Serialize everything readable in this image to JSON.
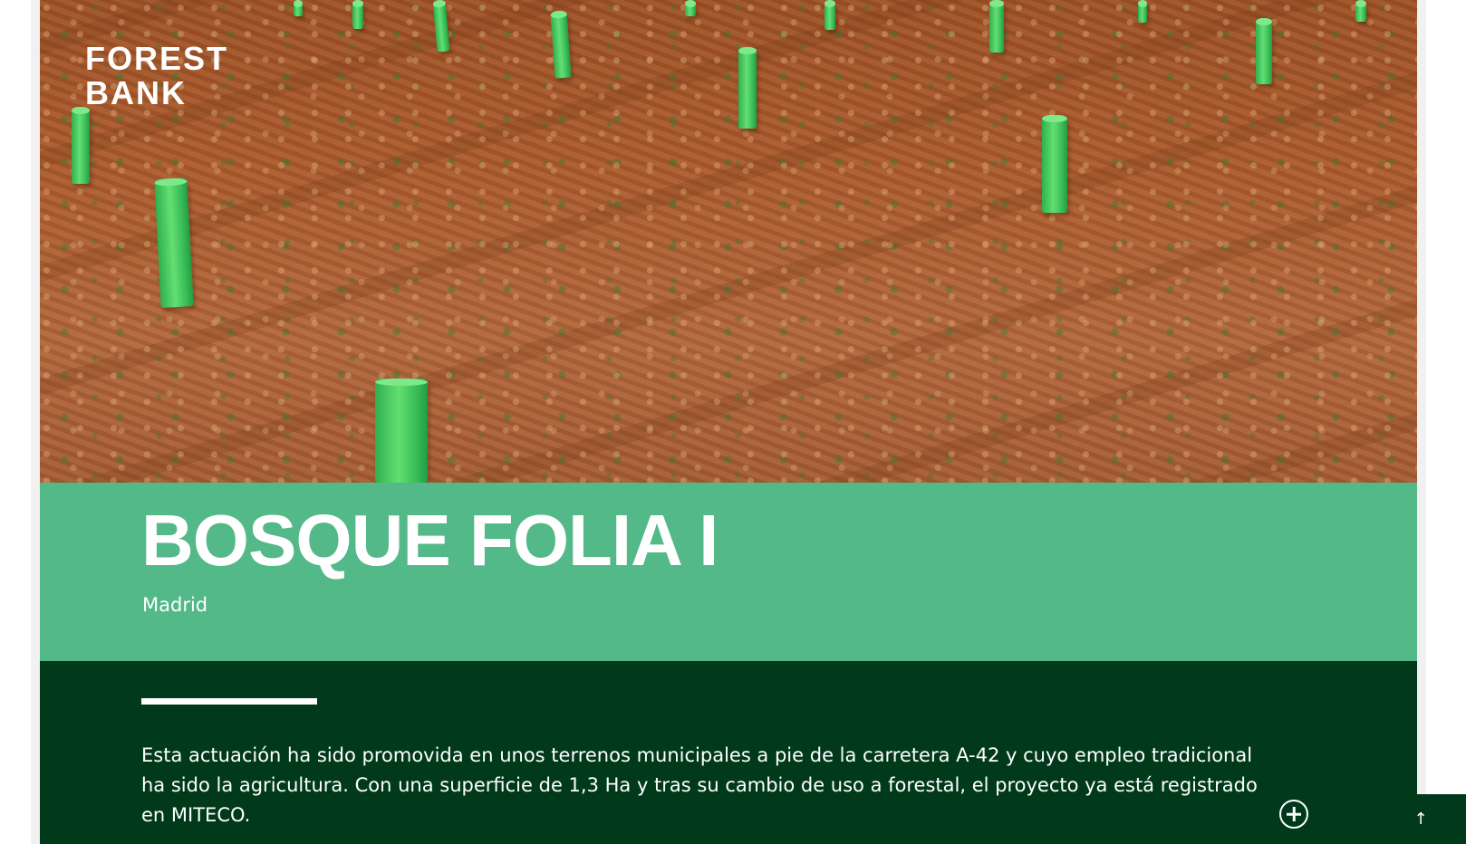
{
  "brand": {
    "logo_line1": "FOREST",
    "logo_line2": "BANK"
  },
  "project": {
    "title": "BOSQUE FOLIA I",
    "location": "Madrid",
    "description": "Esta actuación ha sido promovida en unos terrenos municipales a pie de la carretera A-42 y cuyo empleo tradicional ha sido la agricultura. Con una superficie de 1,3 Ha y tras su cambio de uso a forestal, el proyecto ya está registrado en MITECO."
  },
  "controls": {
    "expand_icon": "plus-circle-icon",
    "scroll_top_icon": "arrow-up-icon",
    "scroll_top_glyph": "↑"
  },
  "colors": {
    "title_band": "#53b989",
    "description_band": "#003a1b",
    "tube_green": "#4ccf66",
    "soil": "#a9592c"
  }
}
